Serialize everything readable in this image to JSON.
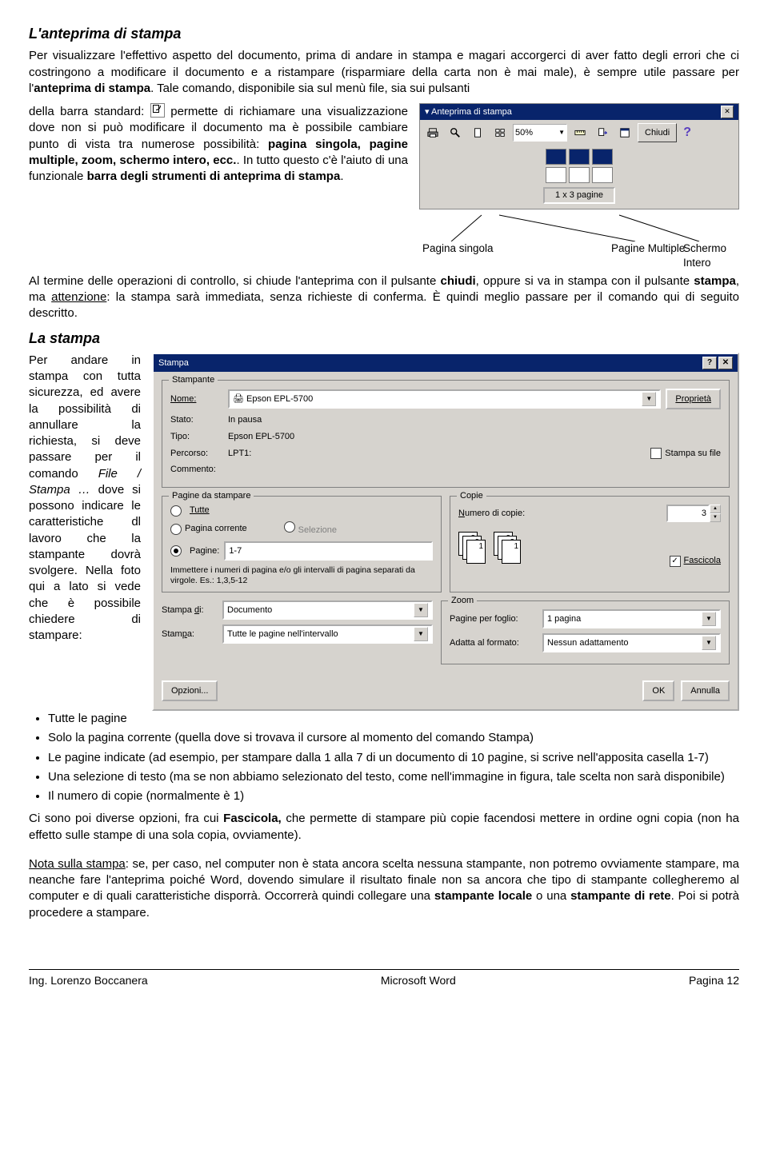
{
  "h1": "L'anteprima di stampa",
  "p1a": "Per visualizzare l'effettivo aspetto del documento, prima di andare in stampa e magari accorgerci di aver fatto degli errori che ci costringono a modificare il documento e a ristampare (risparmiare della carta non è mai male), è sempre utile passare per l'",
  "p1b": "anteprima di stampa",
  "p1c": ". Tale comando, disponibile sia sul menù file, sia sui pulsanti",
  "p2a": "della barra standard: ",
  "p2b": " permette di richiamare una visualizzazione dove non si può modificare il documento ma è possibile cambiare punto di vista tra numerose possibilità: ",
  "p2c": "pagina singola, pagine multiple, zoom, schermo intero, ecc.",
  "p2d": ". In tutto questo c'è l'aiuto di una funzionale ",
  "p2e": "barra degli strumenti di anteprima di stampa",
  "p2f": ".",
  "p3a": "Al termine delle operazioni di controllo, si chiude l'anteprima con il pulsante ",
  "p3b": "chiudi",
  "p3c": ", oppure si va in stampa con il pulsante ",
  "p3d": "stampa",
  "p3e": ", ma ",
  "p3f": "attenzione",
  "p3g": ": la stampa sarà immediata, senza richieste di conferma. È quindi meglio passare per il comando qui di seguito descritto.",
  "h2": "La stampa",
  "p4a": "Per andare in stampa con tutta sicurezza, ed avere la possibilità di annullare la richiesta, si deve passare per il comando ",
  "p4b": "File / Stampa …",
  "p4c": " dove si possono indicare le caratteristiche dl lavoro che la stampante dovrà svolgere. Nella foto qui a lato si vede che è possibile chiedere di stampare:",
  "bul1": "Tutte le pagine",
  "bul2": "Solo la pagina corrente (quella dove si trovava il cursore al momento del comando Stampa)",
  "bul3": "Le pagine indicate (ad esempio, per stampare dalla 1 alla 7 di un documento di 10 pagine, si scrive nell'apposita casella 1-7)",
  "bul4": "Una selezione di testo (ma se non abbiamo selezionato del testo, come nell'immagine in figura, tale scelta non sarà disponibile)",
  "bul5": "Il numero di copie (normalmente è 1)",
  "p5a": "Ci sono poi diverse opzioni, fra cui ",
  "p5b": "Fascicola,",
  "p5c": " che permette di stampare più copie facendosi mettere in ordine ogni copia (non ha effetto sulle stampe di una sola copia, ovviamente).",
  "p6a": "Nota sulla stampa",
  "p6b": ": se, per caso, nel computer non è stata ancora scelta nessuna stampante, non potremo ovviamente stampare, ma neanche fare l'anteprima poiché Word, dovendo simulare il risultato finale non sa ancora che tipo di stampante collegheremo al computer e di quali caratteristiche disporrà. Occorrerà quindi collegare una ",
  "p6c": "stampante locale",
  "p6d": " o una ",
  "p6e": "stampante di rete",
  "p6f": ". Poi si potrà procedere a stampare.",
  "preview": {
    "title": "Anteprima di stampa",
    "zoom": "50%",
    "close": "Chiudi",
    "caption": "1 x 3 pagine",
    "lbl_single": "Pagina singola",
    "lbl_multi": "Pagine Multiple",
    "lbl_full": "Schermo Intero"
  },
  "dlg": {
    "title": "Stampa",
    "grp_printer": "Stampante",
    "name_lbl": "Nome:",
    "name_val": "Epson EPL-5700",
    "props": "Proprietà",
    "state_lbl": "Stato:",
    "state_val": "In pausa",
    "type_lbl": "Tipo:",
    "type_val": "Epson EPL-5700",
    "path_lbl": "Percorso:",
    "path_val": "LPT1:",
    "comment_lbl": "Commento:",
    "tofile": "Stampa su file",
    "grp_pages": "Pagine da stampare",
    "r_all": "Tutte",
    "r_current": "Pagina corrente",
    "r_sel": "Selezione",
    "r_pages": "Pagine:",
    "pages_val": "1-7",
    "hint": "Immettere i numeri di pagina e/o gli intervalli di pagina separati da virgole. Es.: 1,3,5-12",
    "grp_copies": "Copie",
    "copies_lbl": "Numero di copie:",
    "copies_val": "3",
    "fascicola": "Fascicola",
    "stampadi_lbl": "Stampa di:",
    "stampadi_val": "Documento",
    "stampa_lbl": "Stampa:",
    "stampa_val": "Tutte le pagine nell'intervallo",
    "grp_zoom": "Zoom",
    "ppf_lbl": "Pagine per foglio:",
    "ppf_val": "1 pagina",
    "fit_lbl": "Adatta al formato:",
    "fit_val": "Nessun adattamento",
    "options": "Opzioni...",
    "ok": "OK",
    "cancel": "Annulla"
  },
  "footer": {
    "left": "Ing. Lorenzo Boccanera",
    "center": "Microsoft Word",
    "right": "Pagina 12"
  }
}
